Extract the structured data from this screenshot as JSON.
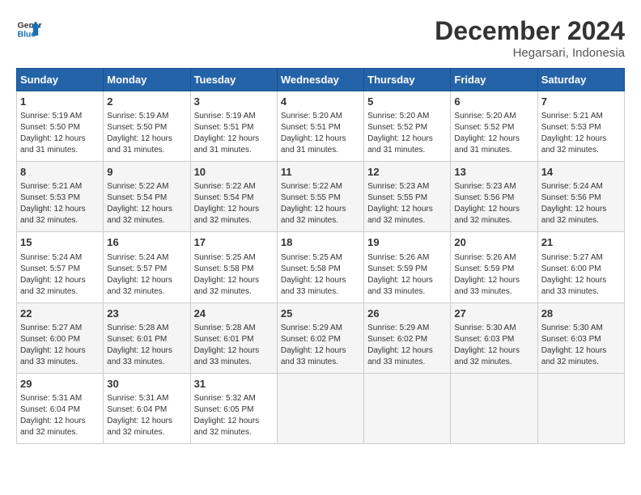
{
  "logo": {
    "line1": "General",
    "line2": "Blue"
  },
  "title": "December 2024",
  "subtitle": "Hegarsari, Indonesia",
  "days_header": [
    "Sunday",
    "Monday",
    "Tuesday",
    "Wednesday",
    "Thursday",
    "Friday",
    "Saturday"
  ],
  "weeks": [
    [
      {
        "day": "1",
        "sunrise": "5:19 AM",
        "sunset": "5:50 PM",
        "daylight": "12 hours and 31 minutes."
      },
      {
        "day": "2",
        "sunrise": "5:19 AM",
        "sunset": "5:50 PM",
        "daylight": "12 hours and 31 minutes."
      },
      {
        "day": "3",
        "sunrise": "5:19 AM",
        "sunset": "5:51 PM",
        "daylight": "12 hours and 31 minutes."
      },
      {
        "day": "4",
        "sunrise": "5:20 AM",
        "sunset": "5:51 PM",
        "daylight": "12 hours and 31 minutes."
      },
      {
        "day": "5",
        "sunrise": "5:20 AM",
        "sunset": "5:52 PM",
        "daylight": "12 hours and 31 minutes."
      },
      {
        "day": "6",
        "sunrise": "5:20 AM",
        "sunset": "5:52 PM",
        "daylight": "12 hours and 31 minutes."
      },
      {
        "day": "7",
        "sunrise": "5:21 AM",
        "sunset": "5:53 PM",
        "daylight": "12 hours and 32 minutes."
      }
    ],
    [
      {
        "day": "8",
        "sunrise": "5:21 AM",
        "sunset": "5:53 PM",
        "daylight": "12 hours and 32 minutes."
      },
      {
        "day": "9",
        "sunrise": "5:22 AM",
        "sunset": "5:54 PM",
        "daylight": "12 hours and 32 minutes."
      },
      {
        "day": "10",
        "sunrise": "5:22 AM",
        "sunset": "5:54 PM",
        "daylight": "12 hours and 32 minutes."
      },
      {
        "day": "11",
        "sunrise": "5:22 AM",
        "sunset": "5:55 PM",
        "daylight": "12 hours and 32 minutes."
      },
      {
        "day": "12",
        "sunrise": "5:23 AM",
        "sunset": "5:55 PM",
        "daylight": "12 hours and 32 minutes."
      },
      {
        "day": "13",
        "sunrise": "5:23 AM",
        "sunset": "5:56 PM",
        "daylight": "12 hours and 32 minutes."
      },
      {
        "day": "14",
        "sunrise": "5:24 AM",
        "sunset": "5:56 PM",
        "daylight": "12 hours and 32 minutes."
      }
    ],
    [
      {
        "day": "15",
        "sunrise": "5:24 AM",
        "sunset": "5:57 PM",
        "daylight": "12 hours and 32 minutes."
      },
      {
        "day": "16",
        "sunrise": "5:24 AM",
        "sunset": "5:57 PM",
        "daylight": "12 hours and 32 minutes."
      },
      {
        "day": "17",
        "sunrise": "5:25 AM",
        "sunset": "5:58 PM",
        "daylight": "12 hours and 32 minutes."
      },
      {
        "day": "18",
        "sunrise": "5:25 AM",
        "sunset": "5:58 PM",
        "daylight": "12 hours and 33 minutes."
      },
      {
        "day": "19",
        "sunrise": "5:26 AM",
        "sunset": "5:59 PM",
        "daylight": "12 hours and 33 minutes."
      },
      {
        "day": "20",
        "sunrise": "5:26 AM",
        "sunset": "5:59 PM",
        "daylight": "12 hours and 33 minutes."
      },
      {
        "day": "21",
        "sunrise": "5:27 AM",
        "sunset": "6:00 PM",
        "daylight": "12 hours and 33 minutes."
      }
    ],
    [
      {
        "day": "22",
        "sunrise": "5:27 AM",
        "sunset": "6:00 PM",
        "daylight": "12 hours and 33 minutes."
      },
      {
        "day": "23",
        "sunrise": "5:28 AM",
        "sunset": "6:01 PM",
        "daylight": "12 hours and 33 minutes."
      },
      {
        "day": "24",
        "sunrise": "5:28 AM",
        "sunset": "6:01 PM",
        "daylight": "12 hours and 33 minutes."
      },
      {
        "day": "25",
        "sunrise": "5:29 AM",
        "sunset": "6:02 PM",
        "daylight": "12 hours and 33 minutes."
      },
      {
        "day": "26",
        "sunrise": "5:29 AM",
        "sunset": "6:02 PM",
        "daylight": "12 hours and 33 minutes."
      },
      {
        "day": "27",
        "sunrise": "5:30 AM",
        "sunset": "6:03 PM",
        "daylight": "12 hours and 32 minutes."
      },
      {
        "day": "28",
        "sunrise": "5:30 AM",
        "sunset": "6:03 PM",
        "daylight": "12 hours and 32 minutes."
      }
    ],
    [
      {
        "day": "29",
        "sunrise": "5:31 AM",
        "sunset": "6:04 PM",
        "daylight": "12 hours and 32 minutes."
      },
      {
        "day": "30",
        "sunrise": "5:31 AM",
        "sunset": "6:04 PM",
        "daylight": "12 hours and 32 minutes."
      },
      {
        "day": "31",
        "sunrise": "5:32 AM",
        "sunset": "6:05 PM",
        "daylight": "12 hours and 32 minutes."
      },
      null,
      null,
      null,
      null
    ]
  ]
}
